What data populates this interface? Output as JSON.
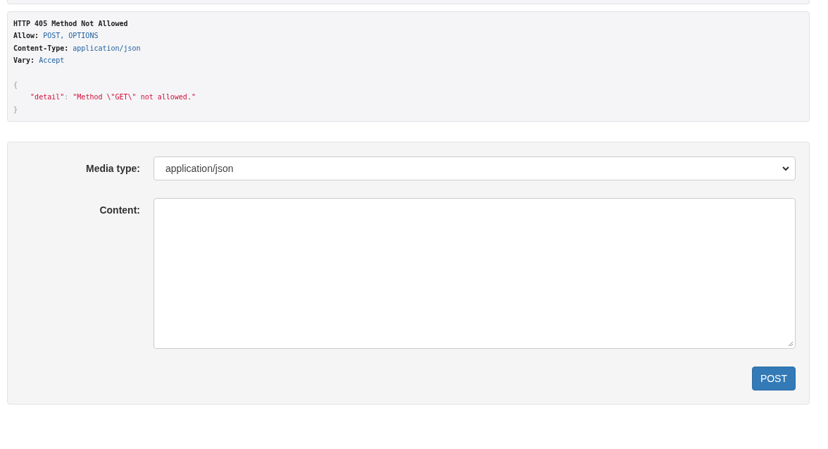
{
  "response": {
    "status_line": "HTTP 405 Method Not Allowed",
    "headers": [
      {
        "name": "Allow:",
        "value": "POST, OPTIONS"
      },
      {
        "name": "Content-Type:",
        "value": "application/json"
      },
      {
        "name": "Vary:",
        "value": "Accept"
      }
    ],
    "body": {
      "open": "{",
      "key": "\"detail\"",
      "separator": ":",
      "value": "\"Method \\\"GET\\\" not allowed.\"",
      "close": "}"
    }
  },
  "form": {
    "fields": [
      {
        "kind": "select",
        "label": "Media type:",
        "value": "application/json"
      },
      {
        "kind": "textarea",
        "label": "Content:"
      }
    ],
    "submit": "POST"
  }
}
